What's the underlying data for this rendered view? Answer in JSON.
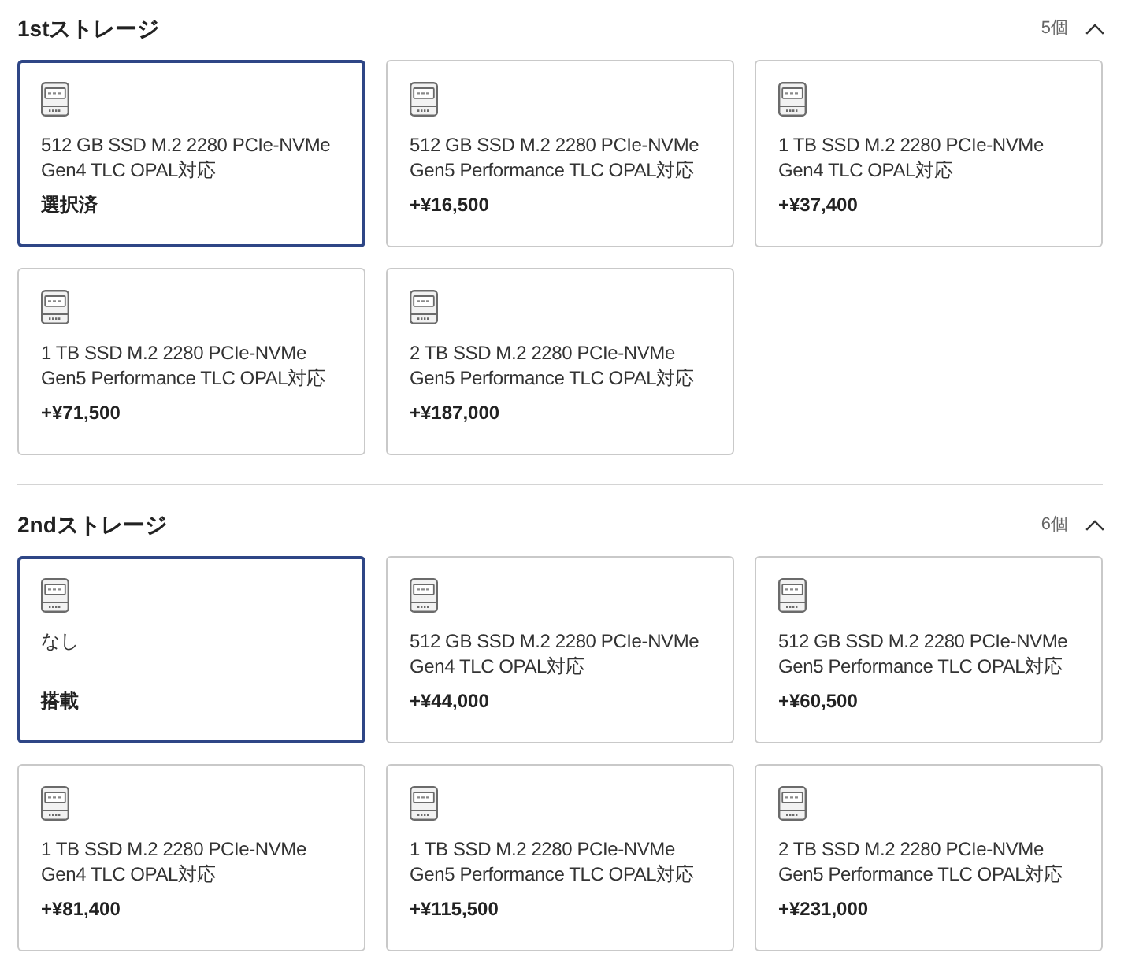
{
  "sections": [
    {
      "title": "1stストレージ",
      "count": "5個",
      "expanded": true,
      "options": [
        {
          "name": "512 GB SSD M.2 2280 PCIe-NVMe Gen4 TLC OPAL対応",
          "price": "選択済",
          "selected": true
        },
        {
          "name": "512 GB SSD M.2 2280 PCIe-NVMe Gen5 Performance TLC OPAL対応",
          "price": "+¥16,500",
          "selected": false
        },
        {
          "name": "1 TB SSD M.2 2280 PCIe-NVMe Gen4 TLC OPAL対応",
          "price": "+¥37,400",
          "selected": false
        },
        {
          "name": "1 TB SSD M.2 2280 PCIe-NVMe Gen5 Performance TLC OPAL対応",
          "price": "+¥71,500",
          "selected": false
        },
        {
          "name": "2 TB SSD M.2 2280 PCIe-NVMe Gen5 Performance TLC OPAL対応",
          "price": "+¥187,000",
          "selected": false
        }
      ]
    },
    {
      "title": "2ndストレージ",
      "count": "6個",
      "expanded": true,
      "options": [
        {
          "name": "なし",
          "price": "搭載",
          "selected": true
        },
        {
          "name": "512 GB SSD M.2 2280 PCIe-NVMe Gen4 TLC OPAL対応",
          "price": "+¥44,000",
          "selected": false
        },
        {
          "name": "512 GB SSD M.2 2280 PCIe-NVMe Gen5 Performance TLC OPAL対応",
          "price": "+¥60,500",
          "selected": false
        },
        {
          "name": "1 TB SSD M.2 2280 PCIe-NVMe Gen4 TLC OPAL対応",
          "price": "+¥81,400",
          "selected": false
        },
        {
          "name": "1 TB SSD M.2 2280 PCIe-NVMe Gen5 Performance TLC OPAL対応",
          "price": "+¥115,500",
          "selected": false
        },
        {
          "name": "2 TB SSD M.2 2280 PCIe-NVMe Gen5 Performance TLC OPAL対応",
          "price": "+¥231,000",
          "selected": false
        }
      ]
    }
  ]
}
